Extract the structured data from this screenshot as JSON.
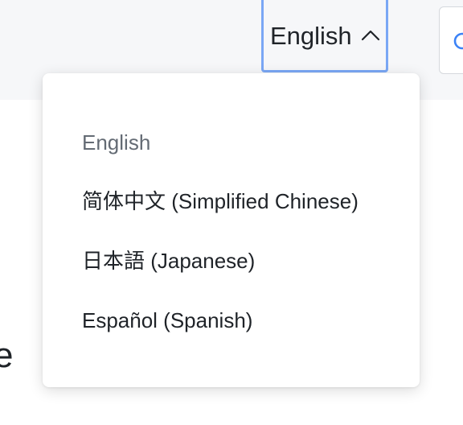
{
  "header": {
    "language_selector": {
      "current": "English",
      "icon": "chevron-up-icon",
      "focus_color": "#7aa7f5"
    },
    "search": {
      "icon": "search-icon",
      "icon_color": "#3b82f6"
    }
  },
  "background": {
    "partial_text": "e"
  },
  "language_menu": {
    "items": [
      {
        "label": "English",
        "selected": true
      },
      {
        "label": "简体中文 (Simplified Chinese)",
        "selected": false
      },
      {
        "label": "日本語 (Japanese)",
        "selected": false
      },
      {
        "label": "Español (Spanish)",
        "selected": false
      }
    ]
  }
}
